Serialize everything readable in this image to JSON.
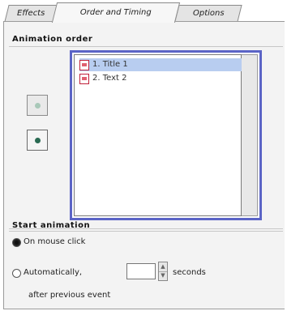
{
  "tabs": [
    {
      "label": "Effects"
    },
    {
      "label": "Order and Timing"
    },
    {
      "label": "Options"
    }
  ],
  "animation_order": {
    "title": "Animation order",
    "items": [
      {
        "label": "1. Title 1",
        "selected": true
      },
      {
        "label": "2. Text 2",
        "selected": false
      }
    ],
    "move_up_icon": "up-dot-icon",
    "move_down_icon": "down-dot-icon"
  },
  "start_animation": {
    "title": "Start animation",
    "on_mouse_click_label": "On mouse click",
    "automatically_label": "Automatically,",
    "seconds_value": "",
    "seconds_label": "seconds",
    "after_label": "after previous event"
  },
  "colors": {
    "list_focus_border": "#5b64c6",
    "selection": "#b8cdf0"
  }
}
